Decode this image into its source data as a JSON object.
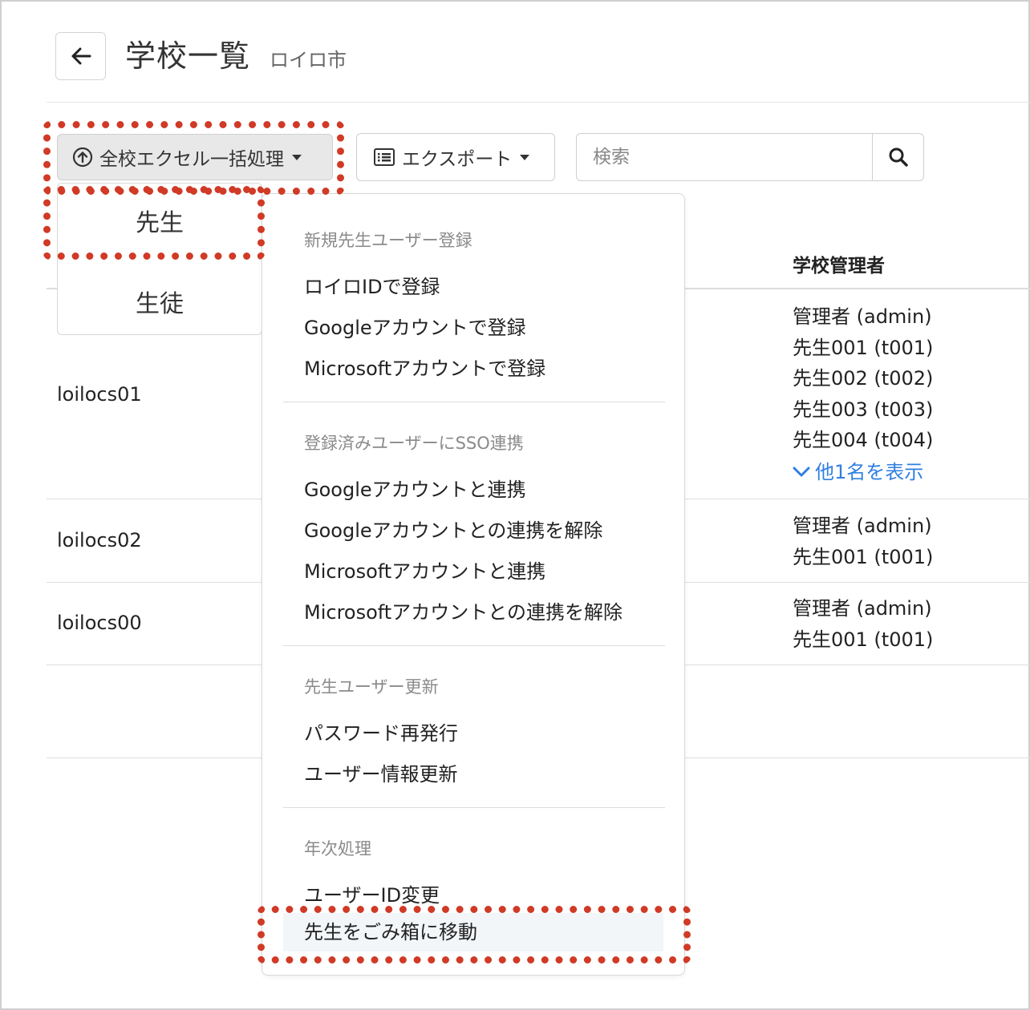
{
  "header": {
    "title": "学校一覧",
    "subtitle": "ロイロ市",
    "back_icon": "arrow-left-icon"
  },
  "toolbar": {
    "bulk_label": "全校エクセル一括処理",
    "export_label": "エクスポート",
    "search_placeholder": "検索"
  },
  "table": {
    "admin_header": "学校管理者",
    "rows": [
      {
        "id": "loilocs01",
        "admins": [
          "管理者 (admin)",
          "先生001 (t001)",
          "先生002 (t002)",
          "先生003 (t003)",
          "先生004 (t004)"
        ],
        "show_more": "他1名を表示"
      },
      {
        "id": "loilocs02",
        "admins": [
          "管理者 (admin)",
          "先生001 (t001)"
        ]
      },
      {
        "id": "loilocs00",
        "admins": [
          "管理者 (admin)",
          "先生001 (t001)"
        ]
      }
    ]
  },
  "submenu": {
    "items": [
      "先生",
      "生徒"
    ]
  },
  "dropdown": {
    "sections": [
      {
        "header": "新規先生ユーザー登録",
        "items": [
          "ロイロIDで登録",
          "Googleアカウントで登録",
          "Microsoftアカウントで登録"
        ]
      },
      {
        "header": "登録済みユーザーにSSO連携",
        "items": [
          "Googleアカウントと連携",
          "Googleアカウントとの連携を解除",
          "Microsoftアカウントと連携",
          "Microsoftアカウントとの連携を解除"
        ]
      },
      {
        "header": "先生ユーザー更新",
        "items": [
          "パスワード再発行",
          "ユーザー情報更新"
        ]
      },
      {
        "header": "年次処理",
        "items": [
          "ユーザーID変更",
          "先生をごみ箱に移動"
        ]
      }
    ]
  },
  "colors": {
    "highlight": "#d03a26",
    "link": "#2f7fe0"
  }
}
